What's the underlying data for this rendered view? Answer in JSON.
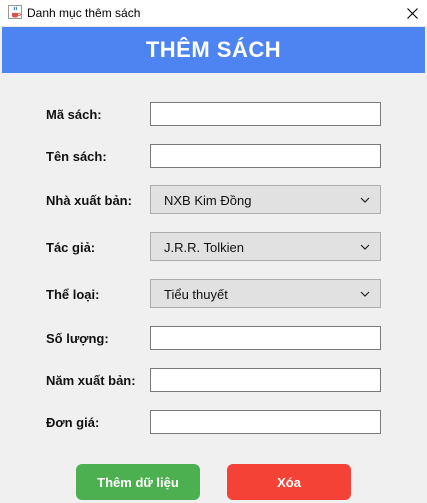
{
  "window": {
    "title": "Danh mục thêm sách",
    "icons": {
      "app": "java-cup-icon",
      "close": "close-icon"
    }
  },
  "header": {
    "title": "THÊM SÁCH",
    "color": "#4d84f2"
  },
  "form": {
    "ma_sach": {
      "label": "Mã sách:",
      "value": ""
    },
    "ten_sach": {
      "label": "Tên sách:",
      "value": ""
    },
    "nha_xuat_ban": {
      "label": "Nhà xuất bản:",
      "selected": "NXB Kim Đồng"
    },
    "tac_gia": {
      "label": "Tác giả:",
      "selected": "J.R.R. Tolkien"
    },
    "the_loai": {
      "label": "Thể loại:",
      "selected": "Tiểu thuyết"
    },
    "so_luong": {
      "label": "Số lượng:",
      "value": ""
    },
    "nam_xuat_ban": {
      "label": "Năm xuất bản:",
      "value": ""
    },
    "don_gia": {
      "label": "Đơn giá:",
      "value": ""
    }
  },
  "buttons": {
    "add_label": "Thêm dữ liệu",
    "add_color": "#4caf50",
    "delete_label": "Xóa",
    "delete_color": "#f44336"
  }
}
